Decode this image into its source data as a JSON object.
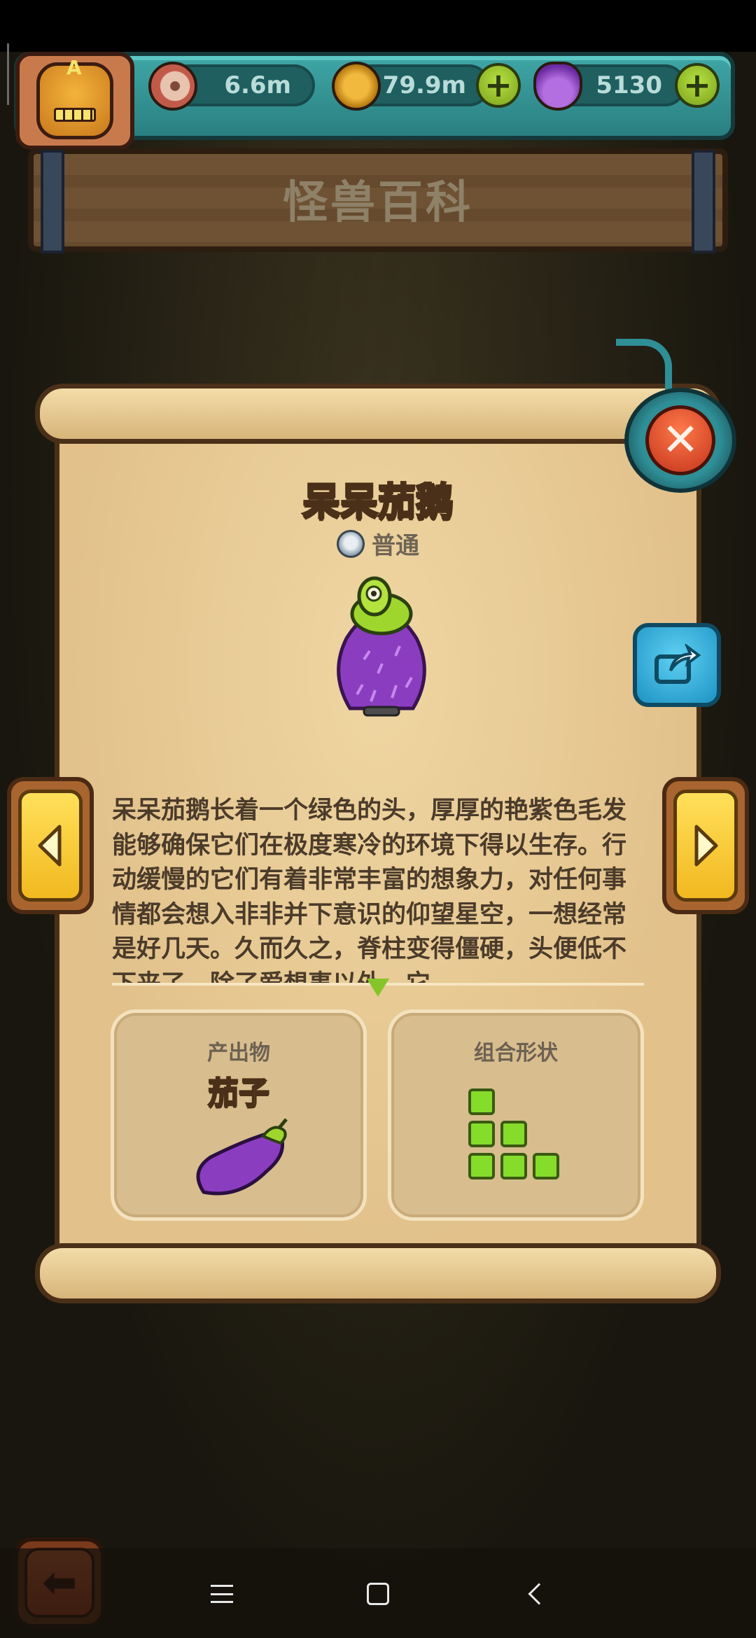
{
  "resources": {
    "eye_amount": "6.6m",
    "coin_amount": "79.9m",
    "potion_amount": "5130"
  },
  "page": {
    "title": "怪兽百科"
  },
  "monster": {
    "name": "呆呆茄鹅",
    "rarity": "普通",
    "description": "呆呆茄鹅长着一个绿色的头，厚厚的艳紫色毛发能够确保它们在极度寒冷的环境下得以生存。行动缓慢的它们有着非常丰富的想象力，对任何事情都会想入非非并下意识的仰望星空，一想经常是好几天。久而久之，脊柱变得僵硬，头便低不下来了。除了爱想事以外，它"
  },
  "product": {
    "label": "产出物",
    "name": "茄子"
  },
  "shape": {
    "label": "组合形状"
  },
  "icons": {
    "eye": "eyeball-icon",
    "coin": "coin-icon",
    "potion": "potion-icon",
    "plus": "plus-icon",
    "close": "close-icon",
    "share": "share-icon",
    "prev": "arrow-left-icon",
    "next": "arrow-right-icon",
    "back": "back-arrow-icon"
  },
  "colors": {
    "accent_teal": "#2f8f97",
    "parchment": "#e2c18b",
    "arrow_yellow": "#f1b81f",
    "shape_green": "#86dc2a",
    "eggplant_purple": "#8b3dbf"
  }
}
